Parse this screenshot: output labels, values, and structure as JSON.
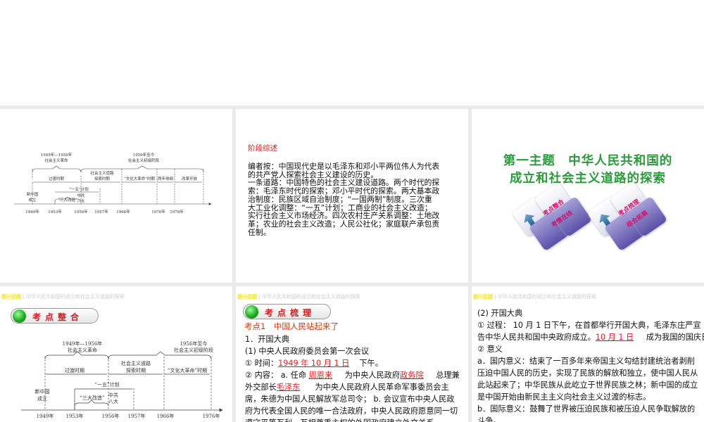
{
  "header_strip": {
    "topic": "第一主题",
    "sep": "|",
    "subtitle": "中华人民共和国的成立和社会主义道路的探索"
  },
  "slide1": {
    "top_left": [
      "1949年—1956年",
      "社会主义革命"
    ],
    "top_right": [
      "1956年至今",
      "社会主义初级阶段"
    ],
    "periods": {
      "guodu": "过渡时期",
      "tansuo1": "社会主义道路",
      "tansuo2": "探索时期",
      "wenge": "“文化大革命”时期",
      "liangnian": "两年徘徊",
      "gaige": "改革开放"
    },
    "yiwu": "“一五”计划",
    "xinzhongguo": [
      "新中国",
      "成立"
    ],
    "sanda": "“三大改造”",
    "bada": [
      "中共",
      "八大"
    ],
    "years": [
      "1949年",
      "1953年",
      "1956年",
      "1957年",
      "1966年",
      "1976年",
      "1978年"
    ]
  },
  "slide2": {
    "heading": "阶段综述",
    "lines": [
      "编者按：中国现代史是以毛泽东和邓小平两位伟人为代表",
      "的共产党人探索社会主义建设的历史。",
      "一条道路：中国特色的社会主义建设道路。两个时代的探",
      "索：毛泽东时代的探索；邓小平时代的探索。两大基本政",
      "治制度：民族区域自治制度；“一国两制”制度。三次重",
      "大工业化调整：“一五”计划；工商业的社会主义改造；",
      "实行社会主义市场经济。四次农村生产关系调整：土地改",
      "革；农业的社会主义改造；人民公社化；家庭联产承包责",
      "任制。"
    ]
  },
  "slide3": {
    "title_lines": [
      "第一主题　中华人民共和国的",
      "成立和社会主义道路的探索"
    ],
    "tile1": [
      "考点整合",
      "考情在线"
    ],
    "tile2": [
      "考点梳理",
      "综合拓展"
    ],
    "colors": {
      "title": "#2a9a3a",
      "tile_text": "#d0116e"
    }
  },
  "slide4": {
    "pill": "考点整合",
    "top_left": [
      "1949年—1956年",
      "社会主义革命"
    ],
    "top_right": [
      "1956年至今",
      "社会主义初级阶段"
    ],
    "periods": {
      "guodu": "过渡时期",
      "tansuo1": "社会主义道路",
      "tansuo2": "探索时期",
      "wenge": "“文化大革命”时期"
    },
    "yiwu": "“一五”计划",
    "xinzhongguo": [
      "新中国",
      "成立"
    ],
    "sanda": "“三大改造”",
    "bada": [
      "中共",
      "八大"
    ],
    "years": [
      "1949年",
      "1953年",
      "1956年",
      "1957年",
      "1966年",
      "1976年"
    ]
  },
  "slide5": {
    "pill": "考点梳理",
    "point": "考点1　中国人民站起来了",
    "lines": [
      [
        {
          "t": "1．开国大典"
        }
      ],
      [
        {
          "t": "(1) 中央人民政府委员会第一次会议"
        }
      ],
      [
        {
          "t": "① 时间："
        },
        {
          "t": "1949 年 10 月 1 日",
          "hl": true
        },
        {
          "t": "下午。"
        }
      ],
      [
        {
          "t": "② 内容： a. 任命 "
        },
        {
          "t": "周恩来",
          "hl": true
        },
        {
          "t": " 为中央人民政府"
        },
        {
          "t": "政务院",
          "hl": true
        },
        {
          "t": " 总理兼"
        }
      ],
      [
        {
          "t": "外交部长"
        },
        {
          "t": "毛泽东",
          "hl": true
        },
        {
          "t": "  为中央人民政府人民革命军事委员会主"
        }
      ],
      [
        {
          "t": "席，朱德为中国人民解放军总司令； b. 会议宣布中央人民政"
        }
      ],
      [
        {
          "t": "府为代表全国人民的唯一合法政府，中央人民政府愿意同一切"
        }
      ],
      [
        {
          "t": "遵守平等互利、互相尊重主权的外国政府建立外交关系。"
        }
      ]
    ]
  },
  "slide6": {
    "lines": [
      [
        {
          "t": "(2) 开国大典"
        }
      ],
      [
        {
          "t": "① 过程： 10 月 1 日下午，在首都举行开国大典，毛泽东庄严宣"
        }
      ],
      [
        {
          "t": "告中华人民共和国中央政府成立。"
        },
        {
          "t": "10 月 1 日",
          "hl": true
        },
        {
          "t": " 成为我国的国庆日。"
        }
      ],
      [
        {
          "t": "② 意义"
        }
      ],
      [
        {
          "t": "a．国内意义：结束了一百多年来帝国主义勾结封建统治者剥削"
        }
      ],
      [
        {
          "t": "压迫中国人民的历史，实现了民族的解放和独立，使中国人民从"
        }
      ],
      [
        {
          "t": "此站起来了；中华民族从此屹立于世界民族之林；新中国的成立"
        }
      ],
      [
        {
          "t": "是中国开始由新民主主义向社会主义过渡的标志。"
        }
      ],
      [
        {
          "t": "b．国际意义：鼓舞了世界被压迫民族和被压迫人民争取解放的"
        }
      ],
      [
        {
          "t": "斗争。"
        }
      ]
    ]
  }
}
